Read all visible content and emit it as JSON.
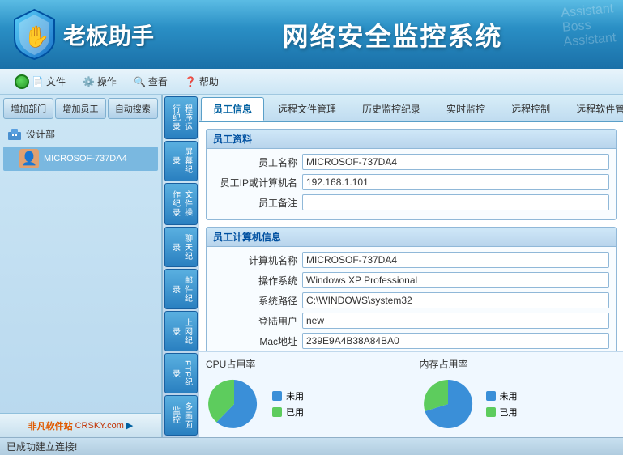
{
  "header": {
    "app_title": "网络安全监控系统",
    "logo_text": "老板助手",
    "watermarks": [
      "Assistant",
      "Boss",
      "Assistant"
    ]
  },
  "toolbar": {
    "items": [
      {
        "label": "文件",
        "icon": "file-icon"
      },
      {
        "label": "操作",
        "icon": "gear-icon"
      },
      {
        "label": "查看",
        "icon": "view-icon"
      },
      {
        "label": "帮助",
        "icon": "help-icon"
      }
    ]
  },
  "sidebar": {
    "buttons": [
      {
        "label": "增加部门"
      },
      {
        "label": "增加员工"
      },
      {
        "label": "自动搜索"
      }
    ],
    "dept_label": "设计部",
    "user_label": "MICROSOF-737DA4"
  },
  "right_sidebar": {
    "items": [
      {
        "label": "程序运行纪录"
      },
      {
        "label": "屏幕纪录"
      },
      {
        "label": "文件操作纪录"
      },
      {
        "label": "聊天纪录"
      },
      {
        "label": "邮件纪录"
      },
      {
        "label": "上网纪录"
      },
      {
        "label": "FTP纪录"
      },
      {
        "label": "多画面监控"
      }
    ]
  },
  "tabs": [
    {
      "label": "员工信息",
      "active": true
    },
    {
      "label": "远程文件管理"
    },
    {
      "label": "历史监控纪录"
    },
    {
      "label": "实时监控"
    },
    {
      "label": "远程控制"
    },
    {
      "label": "远程软件管理"
    }
  ],
  "employee_info": {
    "section_title": "员工资料",
    "fields": [
      {
        "label": "员工名称",
        "value": "MICROSOF-737DA4"
      },
      {
        "label": "员工IP或计算机名",
        "value": "192.168.1.101"
      },
      {
        "label": "员工备注",
        "value": ""
      }
    ]
  },
  "computer_info": {
    "section_title": "员工计算机信息",
    "fields": [
      {
        "label": "计算机名称",
        "value": "MICROSOF-737DA4"
      },
      {
        "label": "操作系统",
        "value": "Windows XP Professional"
      },
      {
        "label": "系统路径",
        "value": "C:\\WINDOWS\\system32"
      },
      {
        "label": "登陆用户",
        "value": "new"
      },
      {
        "label": "Mac地址",
        "value": "239E9A4B38A84BA0"
      }
    ]
  },
  "charts": {
    "cpu": {
      "title": "CPU占用率",
      "unused_color": "#3a8fd8",
      "used_color": "#5dcc5d",
      "unused_label": "未用",
      "used_label": "已用",
      "used_percent": 25
    },
    "memory": {
      "title": "内存占用率",
      "unused_color": "#3a8fd8",
      "used_color": "#5dcc5d",
      "unused_label": "未用",
      "used_label": "已用",
      "used_percent": 35
    }
  },
  "status_bar": {
    "text": "已成功建立连接!"
  },
  "footer": {
    "brand": "非凡软件站",
    "sub": "CRSKY.com"
  }
}
